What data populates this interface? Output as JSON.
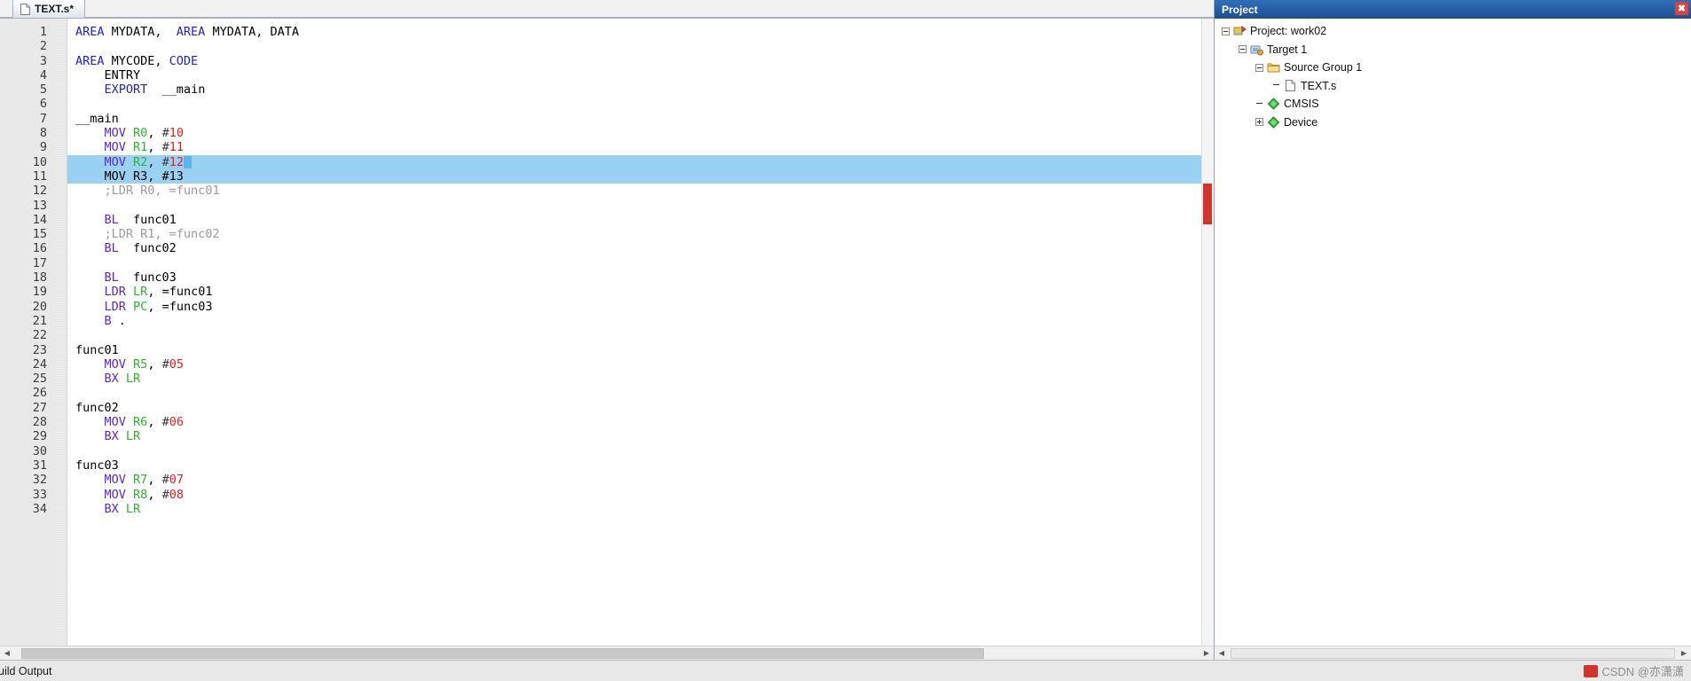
{
  "editor": {
    "tab": {
      "label": "TEXT.s*",
      "icon": "file-icon"
    },
    "first_line": 1,
    "last_line": 34,
    "selected_lines": [
      10,
      11
    ],
    "lines": [
      {
        "n": 1,
        "tokens": [
          {
            "t": "AREA",
            "c": "kw"
          },
          {
            "t": " MYDATA,  ",
            "c": "txt"
          },
          {
            "t": "AREA",
            "c": "kw"
          },
          {
            "t": " MYDATA, DATA",
            "c": "txt"
          }
        ]
      },
      {
        "n": 2,
        "tokens": []
      },
      {
        "n": 3,
        "tokens": [
          {
            "t": "AREA",
            "c": "kw"
          },
          {
            "t": " MYCODE, ",
            "c": "txt"
          },
          {
            "t": "CODE",
            "c": "kw"
          }
        ]
      },
      {
        "n": 4,
        "tokens": [
          {
            "t": "    ENTRY",
            "c": "txt"
          }
        ]
      },
      {
        "n": 5,
        "tokens": [
          {
            "t": "    ",
            "c": "txt"
          },
          {
            "t": "EXPORT",
            "c": "kw"
          },
          {
            "t": "  __main",
            "c": "txt"
          }
        ]
      },
      {
        "n": 6,
        "tokens": []
      },
      {
        "n": 7,
        "tokens": [
          {
            "t": "__main",
            "c": "txt"
          }
        ]
      },
      {
        "n": 8,
        "tokens": [
          {
            "t": "    ",
            "c": "txt"
          },
          {
            "t": "MOV",
            "c": "dir"
          },
          {
            "t": " ",
            "c": "txt"
          },
          {
            "t": "R0",
            "c": "reg"
          },
          {
            "t": ", ",
            "c": "txt"
          },
          {
            "t": "#",
            "c": "hash"
          },
          {
            "t": "10",
            "c": "num"
          }
        ]
      },
      {
        "n": 9,
        "tokens": [
          {
            "t": "    ",
            "c": "txt"
          },
          {
            "t": "MOV",
            "c": "dir"
          },
          {
            "t": " ",
            "c": "txt"
          },
          {
            "t": "R1",
            "c": "reg"
          },
          {
            "t": ", ",
            "c": "txt"
          },
          {
            "t": "#",
            "c": "hash"
          },
          {
            "t": "11",
            "c": "num"
          }
        ]
      },
      {
        "n": 10,
        "tokens": [
          {
            "t": "    ",
            "c": "txt"
          },
          {
            "t": "MOV",
            "c": "dir"
          },
          {
            "t": " ",
            "c": "txt"
          },
          {
            "t": "R2",
            "c": "reg"
          },
          {
            "t": ", ",
            "c": "txt"
          },
          {
            "t": "#",
            "c": "hash"
          },
          {
            "t": "12",
            "c": "num"
          },
          {
            "t": "§caret§",
            "c": "caret"
          }
        ]
      },
      {
        "n": 11,
        "tokens": [
          {
            "t": "    MOV R3, #13",
            "c": "txt"
          }
        ]
      },
      {
        "n": 12,
        "tokens": [
          {
            "t": "    ;LDR R0, =func01",
            "c": "cmt"
          }
        ]
      },
      {
        "n": 13,
        "tokens": []
      },
      {
        "n": 14,
        "tokens": [
          {
            "t": "    ",
            "c": "txt"
          },
          {
            "t": "BL",
            "c": "dir"
          },
          {
            "t": "  func01",
            "c": "txt"
          }
        ]
      },
      {
        "n": 15,
        "tokens": [
          {
            "t": "    ;LDR R1, =func02",
            "c": "cmt"
          }
        ]
      },
      {
        "n": 16,
        "tokens": [
          {
            "t": "    ",
            "c": "txt"
          },
          {
            "t": "BL",
            "c": "dir"
          },
          {
            "t": "  func02",
            "c": "txt"
          }
        ]
      },
      {
        "n": 17,
        "tokens": []
      },
      {
        "n": 18,
        "tokens": [
          {
            "t": "    ",
            "c": "txt"
          },
          {
            "t": "BL",
            "c": "dir"
          },
          {
            "t": "  func03",
            "c": "txt"
          }
        ]
      },
      {
        "n": 19,
        "tokens": [
          {
            "t": "    ",
            "c": "txt"
          },
          {
            "t": "LDR",
            "c": "dir"
          },
          {
            "t": " ",
            "c": "txt"
          },
          {
            "t": "LR",
            "c": "reg"
          },
          {
            "t": ", =func01",
            "c": "txt"
          }
        ]
      },
      {
        "n": 20,
        "tokens": [
          {
            "t": "    ",
            "c": "txt"
          },
          {
            "t": "LDR",
            "c": "dir"
          },
          {
            "t": " ",
            "c": "txt"
          },
          {
            "t": "PC",
            "c": "reg"
          },
          {
            "t": ", =func03",
            "c": "txt"
          }
        ]
      },
      {
        "n": 21,
        "tokens": [
          {
            "t": "    ",
            "c": "txt"
          },
          {
            "t": "B",
            "c": "dir"
          },
          {
            "t": " .",
            "c": "txt"
          }
        ]
      },
      {
        "n": 22,
        "tokens": []
      },
      {
        "n": 23,
        "tokens": [
          {
            "t": "func01",
            "c": "txt"
          }
        ]
      },
      {
        "n": 24,
        "tokens": [
          {
            "t": "    ",
            "c": "txt"
          },
          {
            "t": "MOV",
            "c": "dir"
          },
          {
            "t": " ",
            "c": "txt"
          },
          {
            "t": "R5",
            "c": "reg"
          },
          {
            "t": ", ",
            "c": "txt"
          },
          {
            "t": "#",
            "c": "hash"
          },
          {
            "t": "05",
            "c": "num"
          }
        ]
      },
      {
        "n": 25,
        "tokens": [
          {
            "t": "    ",
            "c": "txt"
          },
          {
            "t": "BX",
            "c": "dir"
          },
          {
            "t": " ",
            "c": "txt"
          },
          {
            "t": "LR",
            "c": "reg"
          }
        ]
      },
      {
        "n": 26,
        "tokens": []
      },
      {
        "n": 27,
        "tokens": [
          {
            "t": "func02",
            "c": "txt"
          }
        ]
      },
      {
        "n": 28,
        "tokens": [
          {
            "t": "    ",
            "c": "txt"
          },
          {
            "t": "MOV",
            "c": "dir"
          },
          {
            "t": " ",
            "c": "txt"
          },
          {
            "t": "R6",
            "c": "reg"
          },
          {
            "t": ", ",
            "c": "txt"
          },
          {
            "t": "#",
            "c": "hash"
          },
          {
            "t": "06",
            "c": "num"
          }
        ]
      },
      {
        "n": 29,
        "tokens": [
          {
            "t": "    ",
            "c": "txt"
          },
          {
            "t": "BX",
            "c": "dir"
          },
          {
            "t": " ",
            "c": "txt"
          },
          {
            "t": "LR",
            "c": "reg"
          }
        ]
      },
      {
        "n": 30,
        "tokens": []
      },
      {
        "n": 31,
        "tokens": [
          {
            "t": "func03",
            "c": "txt"
          }
        ]
      },
      {
        "n": 32,
        "tokens": [
          {
            "t": "    ",
            "c": "txt"
          },
          {
            "t": "MOV",
            "c": "dir"
          },
          {
            "t": " ",
            "c": "txt"
          },
          {
            "t": "R7",
            "c": "reg"
          },
          {
            "t": ", ",
            "c": "txt"
          },
          {
            "t": "#",
            "c": "hash"
          },
          {
            "t": "07",
            "c": "num"
          }
        ]
      },
      {
        "n": 33,
        "tokens": [
          {
            "t": "    ",
            "c": "txt"
          },
          {
            "t": "MOV",
            "c": "dir"
          },
          {
            "t": " ",
            "c": "txt"
          },
          {
            "t": "R8",
            "c": "reg"
          },
          {
            "t": ", ",
            "c": "txt"
          },
          {
            "t": "#",
            "c": "hash"
          },
          {
            "t": "08",
            "c": "num"
          }
        ]
      },
      {
        "n": 34,
        "tokens": [
          {
            "t": "    ",
            "c": "txt"
          },
          {
            "t": "BX",
            "c": "dir"
          },
          {
            "t": " ",
            "c": "txt"
          },
          {
            "t": "LR",
            "c": "reg"
          }
        ]
      }
    ]
  },
  "project": {
    "title": "Project",
    "close_label": "✖",
    "tree": [
      {
        "label": "Project: work02",
        "depth": 0,
        "expander": "minus",
        "icon": "project-icon"
      },
      {
        "label": "Target 1",
        "depth": 1,
        "expander": "minus",
        "icon": "target-icon"
      },
      {
        "label": "Source Group 1",
        "depth": 2,
        "expander": "minus",
        "icon": "folder-icon"
      },
      {
        "label": "TEXT.s",
        "depth": 3,
        "expander": "none",
        "icon": "file-icon"
      },
      {
        "label": "CMSIS",
        "depth": 2,
        "expander": "none",
        "icon": "diamond-icon"
      },
      {
        "label": "Device",
        "depth": 2,
        "expander": "plus",
        "icon": "diamond-icon"
      }
    ]
  },
  "status": {
    "build_output_label": "uild Output",
    "watermark": "CSDN @亦潇潇"
  },
  "colors": {
    "keyword": "#1f1fd1",
    "directive": "#5b27d6",
    "register": "#2db52d",
    "number": "#e81c1c",
    "comment": "#9b9b9b",
    "selection": "#99d1f2",
    "panel_title_bg": "#1e4f8f",
    "close_btn": "#d8443c"
  }
}
